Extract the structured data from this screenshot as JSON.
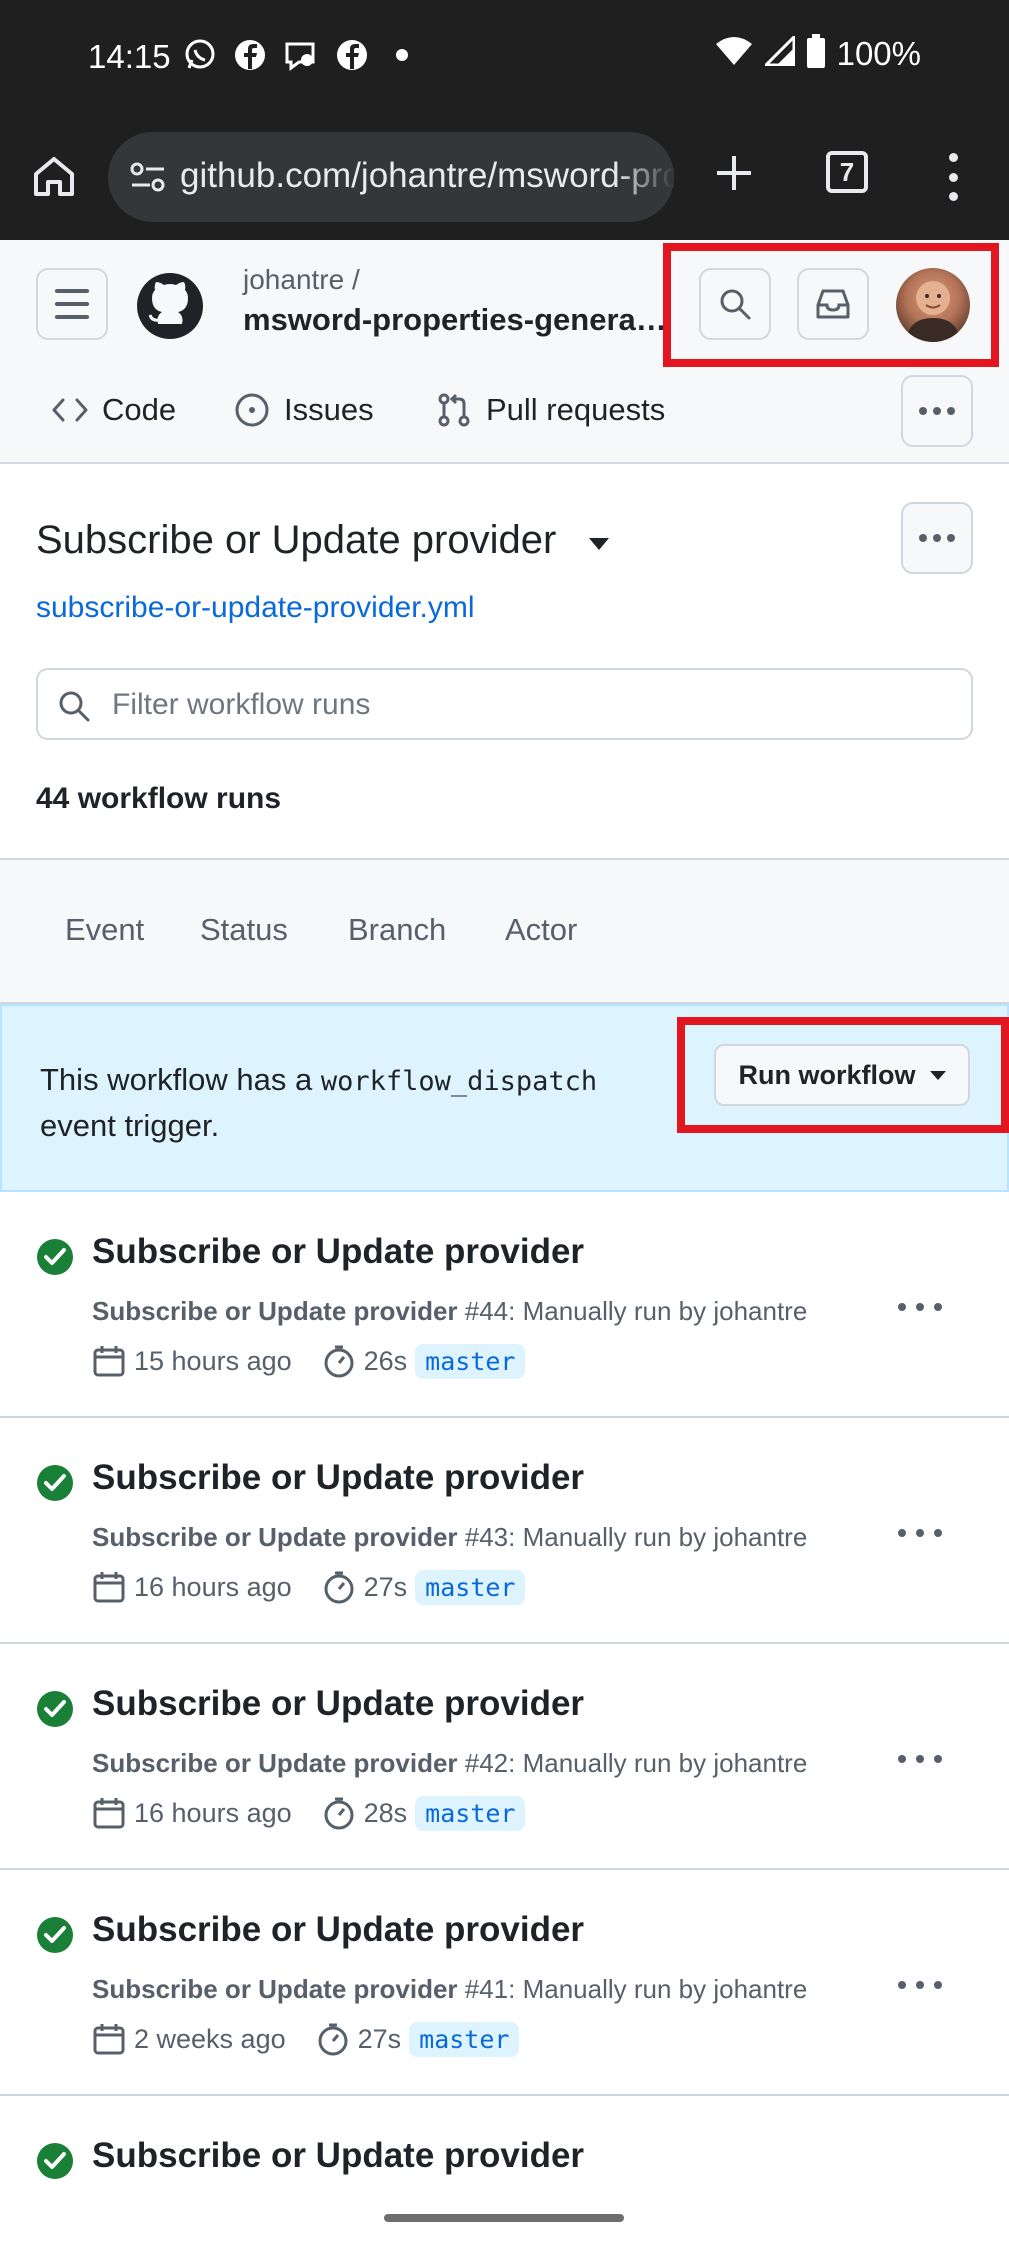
{
  "status_bar": {
    "time": "14:15",
    "battery": "100%",
    "icons": [
      "whatsapp-icon",
      "facebook-icon",
      "messenger-icon",
      "facebook-icon",
      "notification-dot-icon",
      "wifi-icon",
      "signal-icon",
      "battery-icon"
    ]
  },
  "browser": {
    "url": "github.com/johantre/msword-properties-generator/actions",
    "tab_count": "7"
  },
  "repo": {
    "owner": "johantre /",
    "name": "msword-properties-genera…"
  },
  "nav": {
    "code": "Code",
    "issues": "Issues",
    "pulls": "Pull requests"
  },
  "workflow": {
    "title": "Subscribe or Update provider",
    "file": "subscribe-or-update-provider.yml",
    "filter_placeholder": "Filter workflow runs",
    "run_count": "44 workflow runs"
  },
  "filters": {
    "event": "Event",
    "status": "Status",
    "branch": "Branch",
    "actor": "Actor"
  },
  "banner": {
    "text_before": "This workflow has a ",
    "code": "workflow_dispatch",
    "text_after": "event trigger.",
    "run_button": "Run workflow"
  },
  "runs": [
    {
      "title": "Subscribe or Update provider",
      "workflow": "Subscribe or Update provider",
      "detail": " #44: Manually run by johantre",
      "time": "15 hours ago",
      "duration": "26s",
      "branch": "master"
    },
    {
      "title": "Subscribe or Update provider",
      "workflow": "Subscribe or Update provider",
      "detail": " #43: Manually run by johantre",
      "time": "16 hours ago",
      "duration": "27s",
      "branch": "master"
    },
    {
      "title": "Subscribe or Update provider",
      "workflow": "Subscribe or Update provider",
      "detail": " #42: Manually run by johantre",
      "time": "16 hours ago",
      "duration": "28s",
      "branch": "master"
    },
    {
      "title": "Subscribe or Update provider",
      "workflow": "Subscribe or Update provider",
      "detail": " #41: Manually run by johantre",
      "time": "2 weeks ago",
      "duration": "27s",
      "branch": "master"
    },
    {
      "title": "Subscribe or Update provider"
    }
  ],
  "colors": {
    "highlight": "#e3151f",
    "success": "#1a7f37",
    "link": "#0969da",
    "banner_bg": "#ddf4ff"
  }
}
